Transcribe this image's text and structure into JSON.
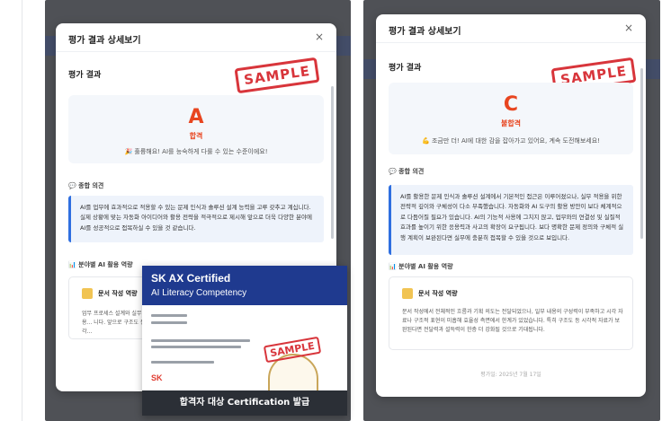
{
  "left_modal": {
    "title": "평가 결과 상세보기",
    "close": "×",
    "section_result": "평가 결과",
    "stamp": "SAMPLE",
    "grade": "A",
    "grade_label": "합격",
    "grade_message": "🎉 훌륭해요! AI를 능숙하게 다룰 수 있는 수준이에요!",
    "section_comment": "💬 종합 의견",
    "comment": "AI를 업무에 효과적으로 적용할 수 있는 문제 인식과 솔루션 설계 능력을 고루 갖추고 계십니다. 실제 상황에 맞는 자동화 아이디어와 활용 전략을 적극적으로 제시해 앞으로 더욱 다양한 분야에 AI를 성공적으로 접목하실 수 있을 것 같습니다.",
    "section_competency": "📊 분야별 AI 활용 역량",
    "competency_name": "문서 작성 역량",
    "competency_desc": "업무 프로세스 설계와 실무 내용... 니다. 앞으로 구조도 등 시각..."
  },
  "certificate": {
    "title": "SK AX Certified",
    "subtitle": "AI Literacy Competency",
    "stamp": "SAMPLE",
    "logo": "SK",
    "banner": "합격자 대상 Certification 발급"
  },
  "right_modal": {
    "title": "평가 결과 상세보기",
    "close": "×",
    "section_result": "평가 결과",
    "stamp": "SAMPLE",
    "grade": "C",
    "grade_label": "불합격",
    "grade_message": "💪 조금만 더! AI에 대한 감을 잡아가고 있어요, 계속 도전해보세요!",
    "section_comment": "💬 종합 의견",
    "comment": "AI를 활용한 문제 인식과 솔루션 설계에서 기본적인 접근은 이루어졌으나, 실무 적용을 위한 전략적 깊이와 구체성이 다소 부족했습니다. 자동화와 AI 도구의 활용 방안이 보다 체계적으로 다듬어질 필요가 있습니다. AI의 기능적 사용에 그치지 않고, 업무와의 연결성 및 실질적 효과를 높이기 위한 응용력과 사고의 확장이 요구됩니다. 보다 명확한 문제 정의와 구체적 실행 계획이 보완된다면 실무에 충분히 접목할 수 있을 것으로 보입니다.",
    "section_competency": "📊 분야별 AI 활용 역량",
    "competency_name": "문서 작성 역량",
    "competency_desc": "문서 작성에서 전체적인 흐름과 기획 의도는 전달되었으나, 일부 내용의 구성력이 부족하고 시각 자료나 구조적 표현이 미흡해 효율성 측면에서 한계가 있었습니다. 특히 구조도 등 시각적 자료가 보완된다면 전달력과 설득력이 한층 더 강화될 것으로 기대됩니다.",
    "footer": "평가일: 2025년 7월 17일"
  }
}
